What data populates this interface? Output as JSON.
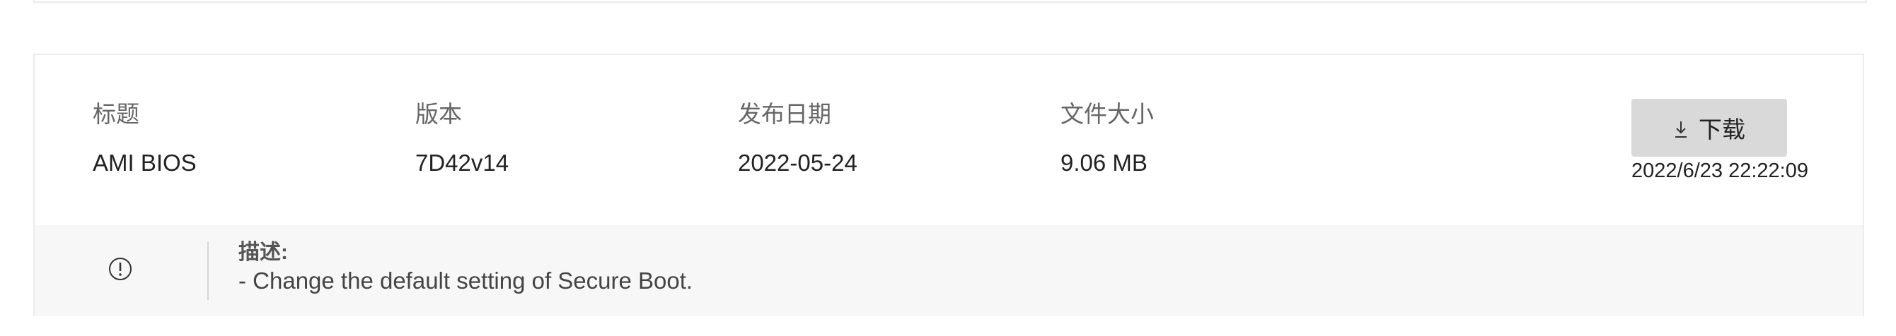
{
  "firmware": {
    "columns": {
      "title_label": "标题",
      "version_label": "版本",
      "date_label": "发布日期",
      "size_label": "文件大小"
    },
    "values": {
      "title": "AMI BIOS",
      "version": "7D42v14",
      "date": "2022-05-24",
      "size": "9.06 MB"
    },
    "download": {
      "label": "下载",
      "icon": "download-arrow-icon"
    },
    "timestamp": "2022/6/23 22:22:09",
    "description": {
      "icon": "info-circle-icon",
      "label": "描述:",
      "text": "- Change the default setting of Secure Boot."
    }
  },
  "colors": {
    "button_bg": "#d9d9d9",
    "panel_bg": "#f7f7f7",
    "border": "#ececec"
  }
}
